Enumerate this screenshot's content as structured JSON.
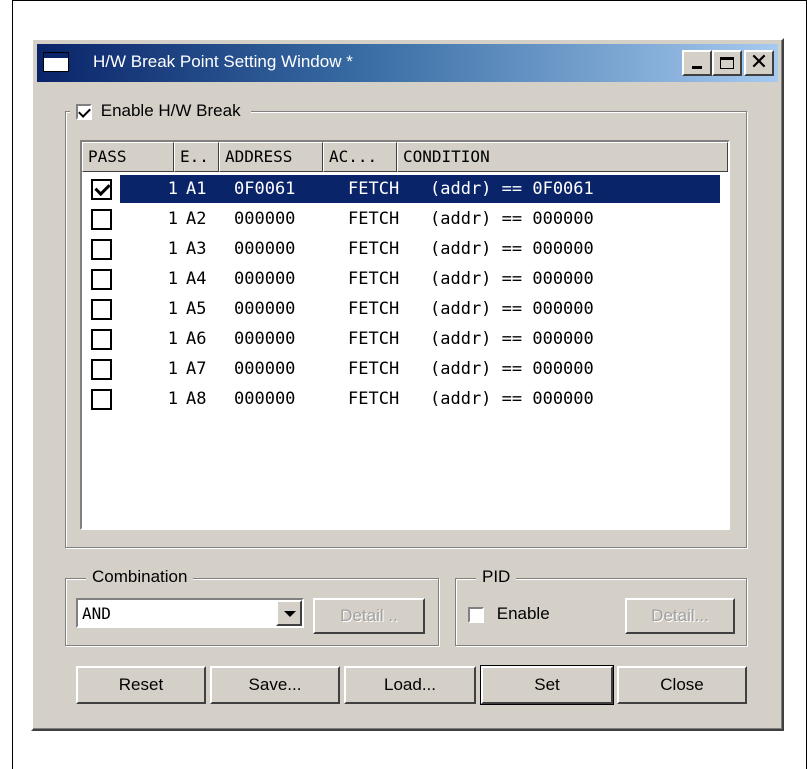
{
  "window": {
    "title": "H/W Break Point Setting Window *"
  },
  "enable_hw_break": {
    "label": "Enable H/W Break",
    "checked": true
  },
  "breakpoint_table": {
    "columns": [
      "PASS",
      "E..",
      "ADDRESS",
      "AC...",
      "CONDITION"
    ],
    "rows": [
      {
        "pass_checked": true,
        "count": "1",
        "event": "A1",
        "address": "0F0061",
        "access": "FETCH",
        "condition": "(addr) == 0F0061",
        "selected": true
      },
      {
        "pass_checked": false,
        "count": "1",
        "event": "A2",
        "address": "000000",
        "access": "FETCH",
        "condition": "(addr) == 000000",
        "selected": false
      },
      {
        "pass_checked": false,
        "count": "1",
        "event": "A3",
        "address": "000000",
        "access": "FETCH",
        "condition": "(addr) == 000000",
        "selected": false
      },
      {
        "pass_checked": false,
        "count": "1",
        "event": "A4",
        "address": "000000",
        "access": "FETCH",
        "condition": "(addr) == 000000",
        "selected": false
      },
      {
        "pass_checked": false,
        "count": "1",
        "event": "A5",
        "address": "000000",
        "access": "FETCH",
        "condition": "(addr) == 000000",
        "selected": false
      },
      {
        "pass_checked": false,
        "count": "1",
        "event": "A6",
        "address": "000000",
        "access": "FETCH",
        "condition": "(addr) == 000000",
        "selected": false
      },
      {
        "pass_checked": false,
        "count": "1",
        "event": "A7",
        "address": "000000",
        "access": "FETCH",
        "condition": "(addr) == 000000",
        "selected": false
      },
      {
        "pass_checked": false,
        "count": "1",
        "event": "A8",
        "address": "000000",
        "access": "FETCH",
        "condition": "(addr) == 000000",
        "selected": false
      }
    ]
  },
  "combination": {
    "group_label": "Combination",
    "selected": "AND",
    "detail_label": "Detail .."
  },
  "pid": {
    "group_label": "PID",
    "enable_label": "Enable",
    "enable_checked": false,
    "detail_label": "Detail..."
  },
  "buttons": {
    "reset": "Reset",
    "save": "Save...",
    "load": "Load...",
    "set": "Set",
    "close": "Close"
  },
  "colors": {
    "selection": "#0a246a",
    "face": "#d4d0c8"
  }
}
